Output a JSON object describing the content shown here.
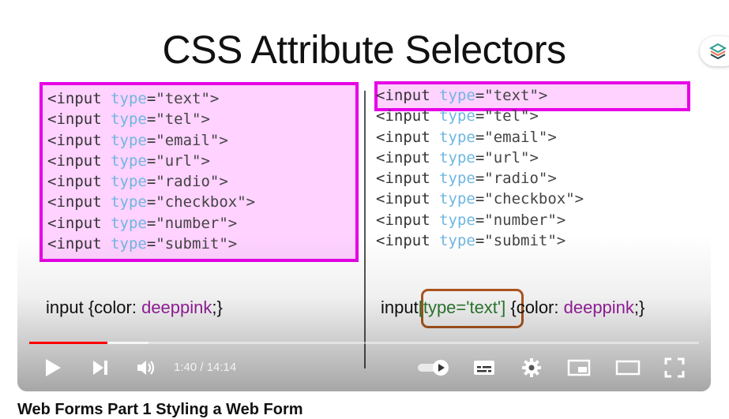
{
  "slide": {
    "title": "CSS Attribute Selectors",
    "code_lines": [
      {
        "tag": "<input ",
        "attr": "type",
        "eq": "=",
        "val": "\"text\">"
      },
      {
        "tag": "<input ",
        "attr": "type",
        "eq": "=",
        "val": "\"tel\">"
      },
      {
        "tag": "<input ",
        "attr": "type",
        "eq": "=",
        "val": "\"email\">"
      },
      {
        "tag": "<input ",
        "attr": "type",
        "eq": "=",
        "val": "\"url\">"
      },
      {
        "tag": "<input ",
        "attr": "type",
        "eq": "=",
        "val": "\"radio\">"
      },
      {
        "tag": "<input ",
        "attr": "type",
        "eq": "=",
        "val": "\"checkbox\">"
      },
      {
        "tag": "<input ",
        "attr": "type",
        "eq": "=",
        "val": "\"number\">"
      },
      {
        "tag": "<input ",
        "attr": "type",
        "eq": "=",
        "val": "\"submit\">"
      }
    ],
    "left_rule": {
      "pre": "input {color: ",
      "kw": "deeppink",
      "post": ";}"
    },
    "right_rule": {
      "pre": "input",
      "sel": "[type='text']",
      "mid": " {color: ",
      "kw": "deeppink",
      "post": ";}"
    }
  },
  "player": {
    "time_display": "1:40 / 14:14",
    "progress_played": 0.117,
    "progress_buffered": 0.178,
    "accent_color": "#ff0000"
  },
  "below_title": "Web Forms Part 1 Styling a Web Form"
}
